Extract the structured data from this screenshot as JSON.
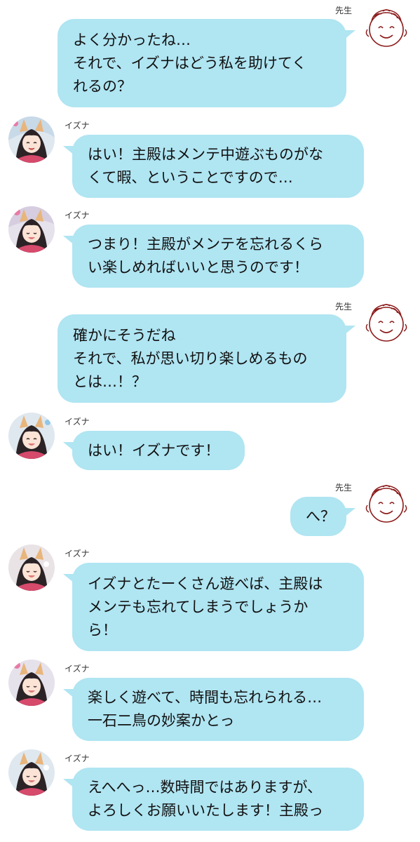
{
  "speakers": {
    "teacher": "先生",
    "izuna": "イズナ"
  },
  "messages": [
    {
      "text": "よく分かったね…\nそれで、イズナはどう私を助けてく\nれるの？"
    },
    {
      "text": "はい！主殿はメンテ中遊ぶものがな\nくて暇、ということですので…"
    },
    {
      "text": "つまり！主殿がメンテを忘れるくら\nい楽しめればいいと思うのです！"
    },
    {
      "text": "確かにそうだね\nそれで、私が思い切り楽しめるもの\nとは…！？"
    },
    {
      "text": "はい！イズナです！"
    },
    {
      "text": "へ？"
    },
    {
      "text": "イズナとたーくさん遊べば、主殿は\nメンテも忘れてしまうでしょうか\nら！"
    },
    {
      "text": "楽しく遊べて、時間も忘れられる…\n一石二鳥の妙案かとっ"
    },
    {
      "text": "えへへっ…数時間ではありますが、\nよろしくお願いいたします！主殿っ"
    }
  ],
  "colors": {
    "bubble": "#b0e5f2",
    "sensei_line": "#8b1a1a"
  },
  "icons": {
    "teacher_avatar": "smiley-face-drawing-icon",
    "izuna_avatar": "izuna-portrait-icon"
  }
}
